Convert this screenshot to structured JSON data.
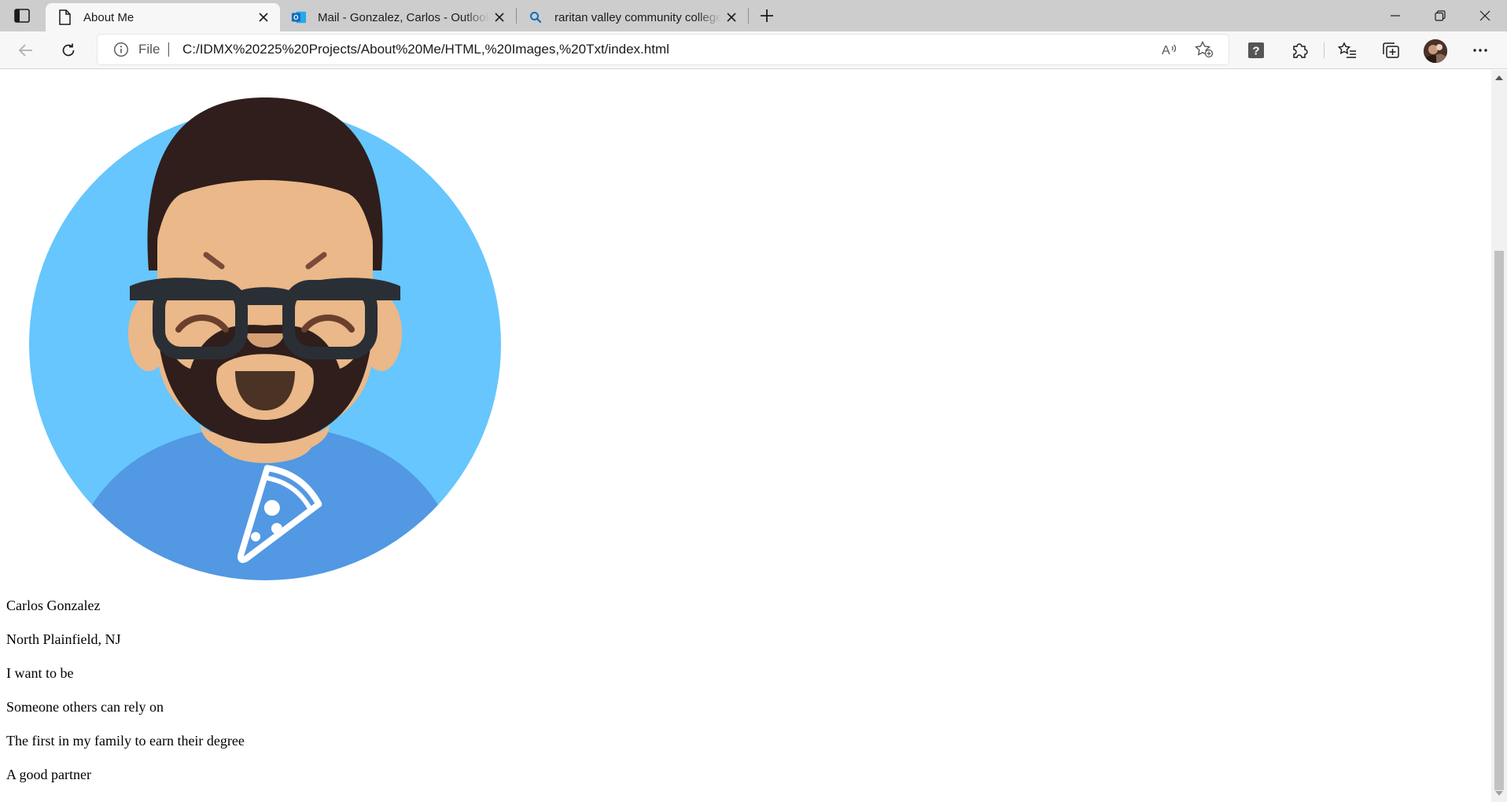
{
  "browser": {
    "tabs": [
      {
        "title": "About Me",
        "active": true,
        "favicon": "page-icon"
      },
      {
        "title": "Mail - Gonzalez, Carlos - Outlook",
        "active": false,
        "favicon": "outlook-icon"
      },
      {
        "title": "raritan valley community college",
        "active": false,
        "favicon": "search-icon"
      }
    ],
    "address": {
      "scheme_label": "File",
      "url": "C:/IDMX%20225%20Projects/About%20Me/HTML,%20Images,%20Txt/index.html"
    },
    "colors": {
      "tabstrip": "#cdcdcd",
      "toolbar": "#f7f7f7",
      "accent": "#0f6cbd"
    }
  },
  "page": {
    "lines": [
      "Carlos Gonzalez",
      "North Plainfield, NJ",
      "I want to be",
      "Someone others can rely on",
      "The first in my family to earn their degree",
      "A good partner"
    ],
    "avatar": {
      "description_icon": "cartoon-man-with-glasses-and-beard",
      "colors": {
        "background": "#66c6fd",
        "shirt": "#5298e3",
        "skin": "#eab889",
        "hair": "#2f1e1b",
        "glasses": "#2a2f35"
      }
    }
  }
}
